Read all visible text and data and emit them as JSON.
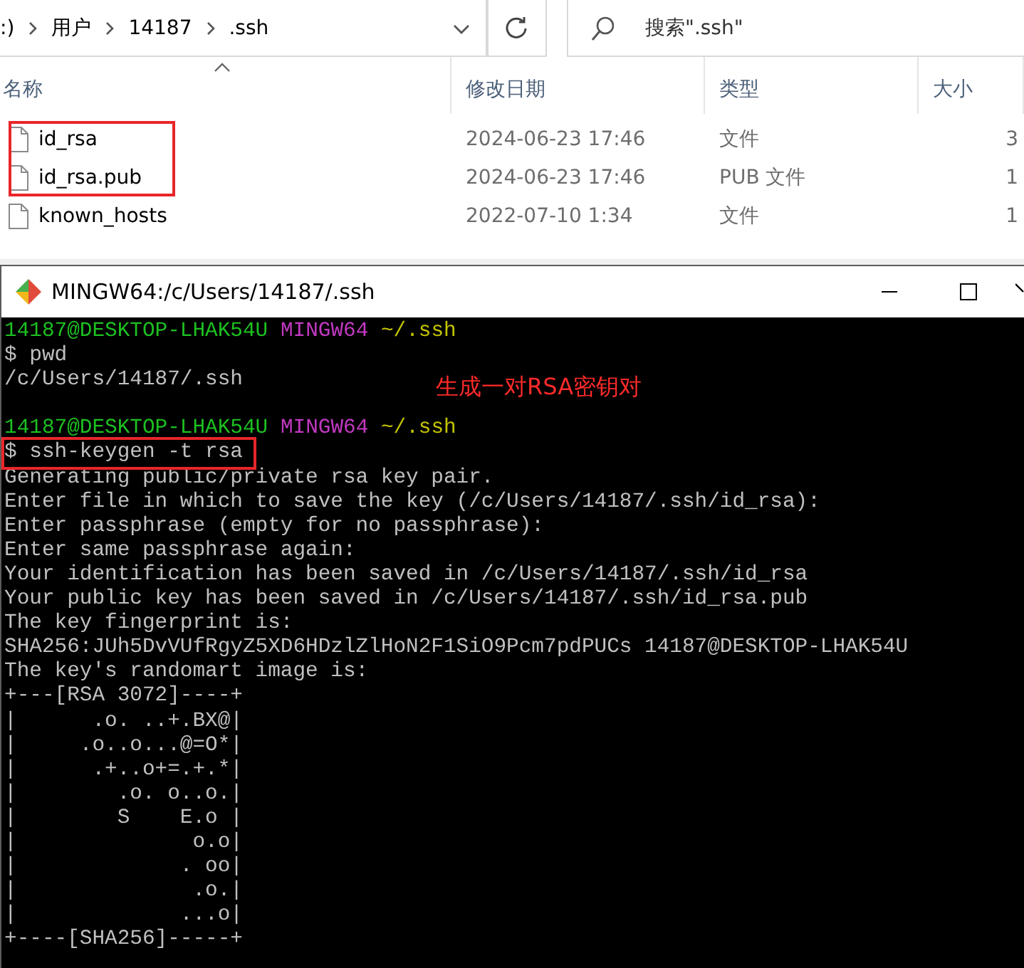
{
  "explorer": {
    "breadcrumb": [
      ":)",
      "用户",
      "14187",
      ".ssh"
    ],
    "search": {
      "placeholder": "搜索\".ssh\""
    },
    "columns": [
      "名称",
      "修改日期",
      "类型",
      "大小"
    ],
    "files": [
      {
        "name": "id_rsa",
        "modified": "2024-06-23 17:46",
        "type": "文件",
        "size": "3",
        "highlighted": true
      },
      {
        "name": "id_rsa.pub",
        "modified": "2024-06-23 17:46",
        "type": "PUB 文件",
        "size": "1",
        "highlighted": true
      },
      {
        "name": "known_hosts",
        "modified": "2022-07-10 1:34",
        "type": "文件",
        "size": "1",
        "highlighted": false
      }
    ]
  },
  "terminal": {
    "title": "MINGW64:/c/Users/14187/.ssh",
    "annotation": "生成一对RSA密钥对",
    "lines": [
      {
        "segments": [
          {
            "text": "14187@DESKTOP-LHAK54U",
            "kind": "user"
          },
          {
            "text": "MINGW64",
            "kind": "host"
          },
          {
            "text": "~/.ssh",
            "kind": "path"
          }
        ]
      },
      {
        "segments": [
          {
            "text": "$ pwd",
            "kind": "plain"
          }
        ]
      },
      {
        "segments": [
          {
            "text": "/c/Users/14187/.ssh",
            "kind": "plain"
          }
        ]
      },
      {
        "kind": "blank"
      },
      {
        "segments": [
          {
            "text": "14187@DESKTOP-LHAK54U",
            "kind": "user"
          },
          {
            "text": "MINGW64",
            "kind": "host"
          },
          {
            "text": "~/.ssh",
            "kind": "path"
          }
        ]
      },
      {
        "segments": [
          {
            "text": "$ ssh-keygen -t rsa",
            "kind": "plain"
          }
        ],
        "highlighted": true
      },
      {
        "segments": [
          {
            "text": "Generating public/private rsa key pair.",
            "kind": "plain"
          }
        ]
      },
      {
        "segments": [
          {
            "text": "Enter file in which to save the key (/c/Users/14187/.ssh/id_rsa):",
            "kind": "plain"
          }
        ]
      },
      {
        "segments": [
          {
            "text": "Enter passphrase (empty for no passphrase):",
            "kind": "plain"
          }
        ]
      },
      {
        "segments": [
          {
            "text": "Enter same passphrase again:",
            "kind": "plain"
          }
        ]
      },
      {
        "segments": [
          {
            "text": "Your identification has been saved in /c/Users/14187/.ssh/id_rsa",
            "kind": "plain"
          }
        ]
      },
      {
        "segments": [
          {
            "text": "Your public key has been saved in /c/Users/14187/.ssh/id_rsa.pub",
            "kind": "plain"
          }
        ]
      },
      {
        "segments": [
          {
            "text": "The key fingerprint is:",
            "kind": "plain"
          }
        ]
      },
      {
        "segments": [
          {
            "text": "SHA256:JUh5DvVUfRgyZ5XD6HDzlZlHoN2F1SiO9Pcm7pdPUCs 14187@DESKTOP-LHAK54U",
            "kind": "plain"
          }
        ]
      },
      {
        "segments": [
          {
            "text": "The key's randomart image is:",
            "kind": "plain"
          }
        ]
      },
      {
        "segments": [
          {
            "text": "+---[RSA 3072]----+",
            "kind": "plain"
          }
        ]
      },
      {
        "segments": [
          {
            "text": "|      .o. ..+.BX@|",
            "kind": "plain"
          }
        ]
      },
      {
        "segments": [
          {
            "text": "|     .o..o...@=O*|",
            "kind": "plain"
          }
        ]
      },
      {
        "segments": [
          {
            "text": "|      .+..o+=.+.*|",
            "kind": "plain"
          }
        ]
      },
      {
        "segments": [
          {
            "text": "|        .o. o..o.|",
            "kind": "plain"
          }
        ]
      },
      {
        "segments": [
          {
            "text": "|        S    E.o |",
            "kind": "plain"
          }
        ]
      },
      {
        "segments": [
          {
            "text": "|              o.o|",
            "kind": "plain"
          }
        ]
      },
      {
        "segments": [
          {
            "text": "|             . oo|",
            "kind": "plain"
          }
        ]
      },
      {
        "segments": [
          {
            "text": "|              .o.|",
            "kind": "plain"
          }
        ]
      },
      {
        "segments": [
          {
            "text": "|             ...o|",
            "kind": "plain"
          }
        ]
      },
      {
        "segments": [
          {
            "text": "+----[SHA256]-----+",
            "kind": "plain"
          }
        ]
      }
    ]
  }
}
